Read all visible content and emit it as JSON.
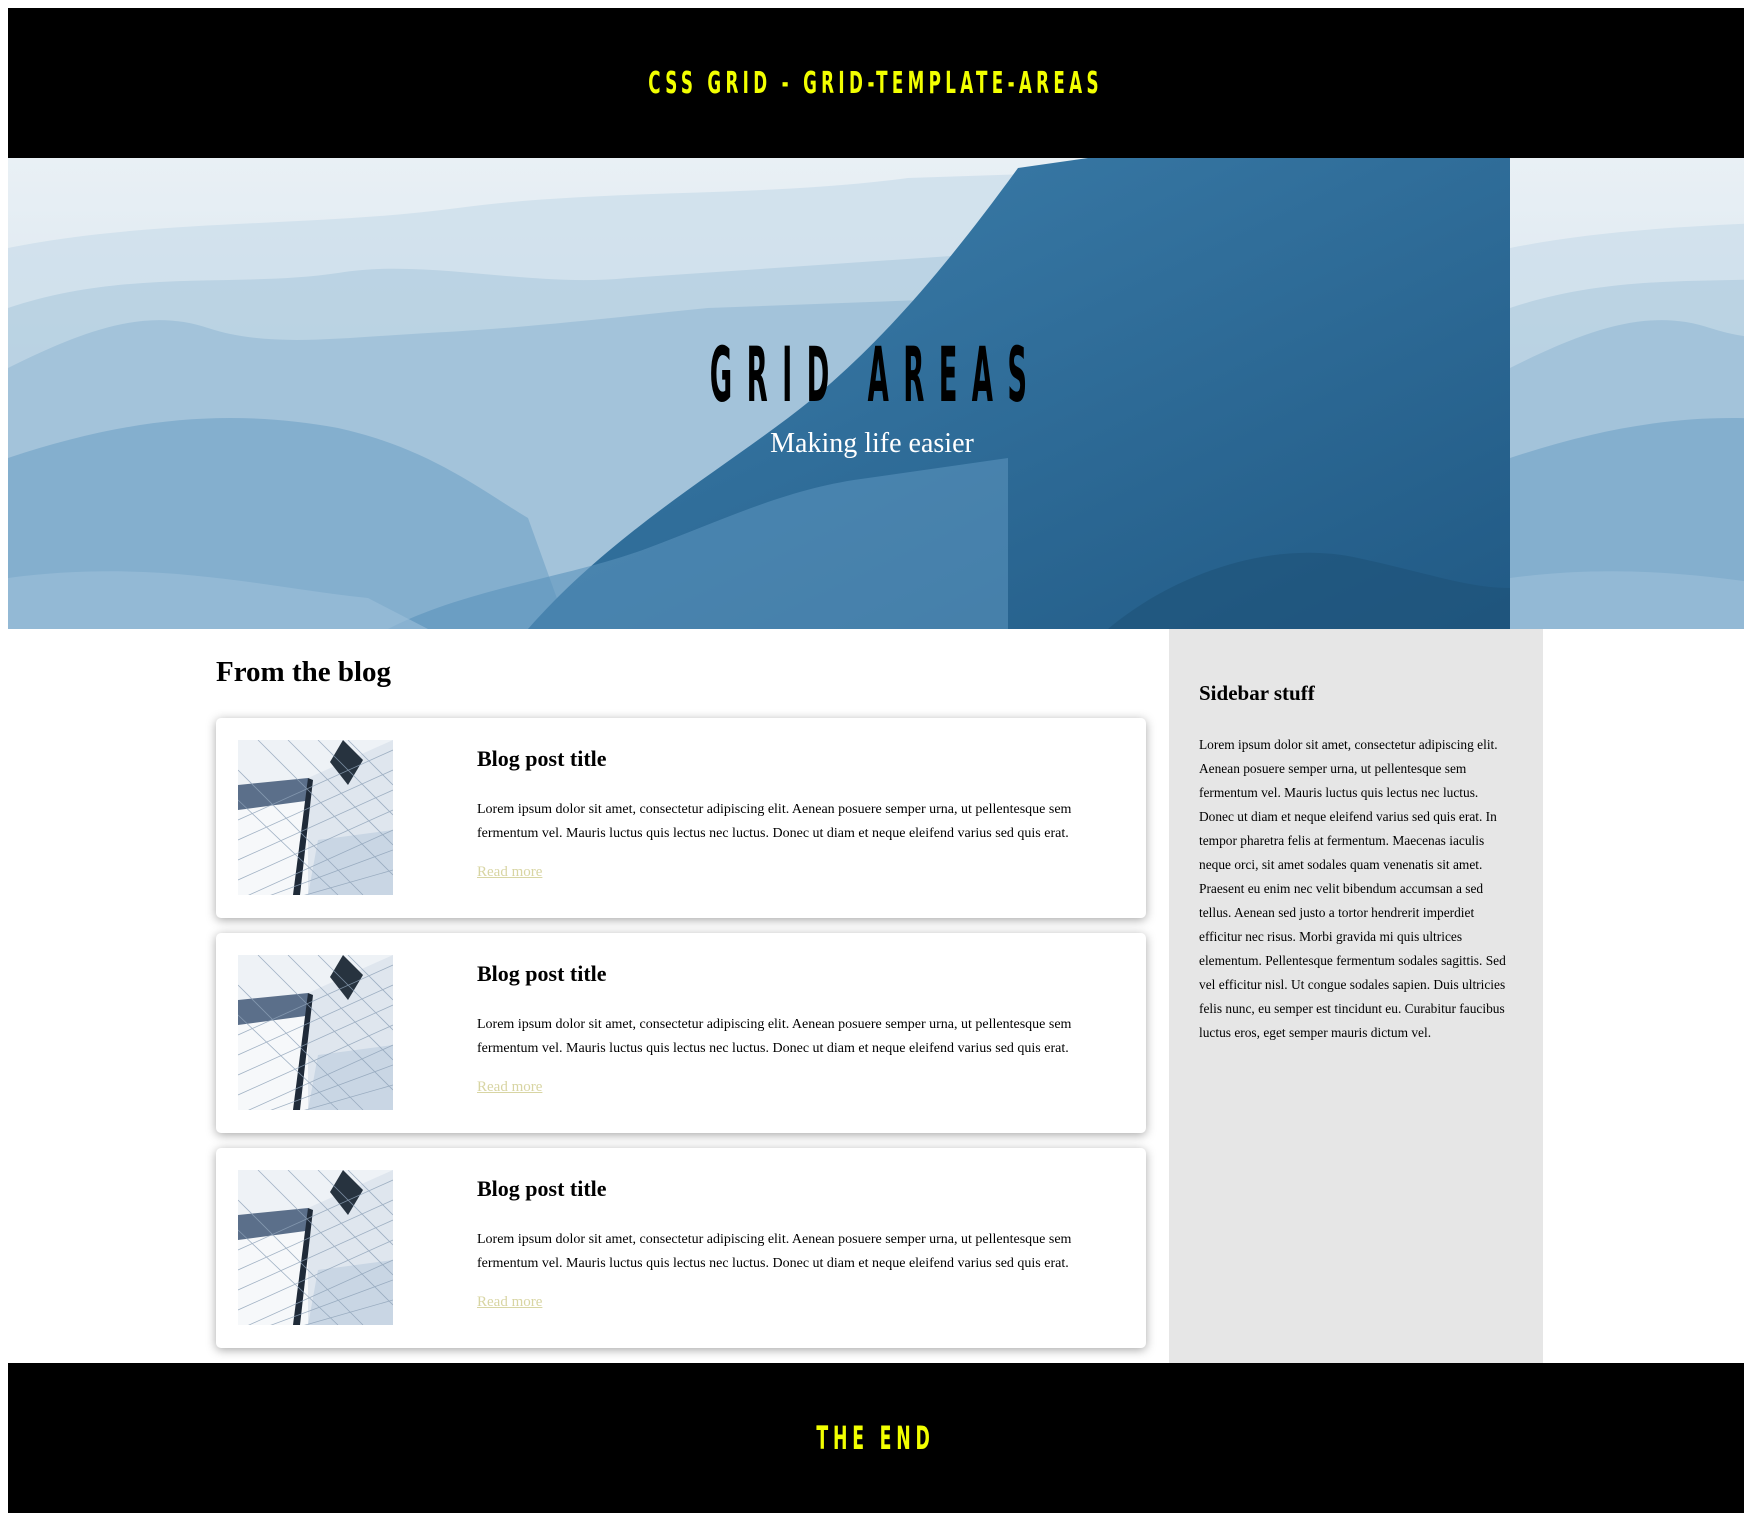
{
  "header": {
    "title": "CSS GRID - GRID-TEMPLATE-AREAS"
  },
  "hero": {
    "title": "GRID AREAS",
    "subtitle": "Making life easier"
  },
  "blog": {
    "heading": "From the blog",
    "posts": [
      {
        "title": "Blog post title",
        "excerpt": "Lorem ipsum dolor sit amet, consectetur adipiscing elit. Aenean posuere semper urna, ut pellentesque sem fermentum vel. Mauris luctus quis lectus nec luctus. Donec ut diam et neque eleifend varius sed quis erat.",
        "link": "Read more"
      },
      {
        "title": "Blog post title",
        "excerpt": "Lorem ipsum dolor sit amet, consectetur adipiscing elit. Aenean posuere semper urna, ut pellentesque sem fermentum vel. Mauris luctus quis lectus nec luctus. Donec ut diam et neque eleifend varius sed quis erat.",
        "link": "Read more"
      },
      {
        "title": "Blog post title",
        "excerpt": "Lorem ipsum dolor sit amet, consectetur adipiscing elit. Aenean posuere semper urna, ut pellentesque sem fermentum vel. Mauris luctus quis lectus nec luctus. Donec ut diam et neque eleifend varius sed quis erat.",
        "link": "Read more"
      }
    ]
  },
  "sidebar": {
    "title": "Sidebar stuff",
    "text": "Lorem ipsum dolor sit amet, consectetur adipiscing elit. Aenean posuere semper urna, ut pellentesque sem fermentum vel. Mauris luctus quis lectus nec luctus. Donec ut diam et neque eleifend varius sed quis erat. In tempor pharetra felis at fermentum. Maecenas iaculis neque orci, sit amet sodales quam venenatis sit amet. Praesent eu enim nec velit bibendum accumsan a sed tellus. Aenean sed justo a tortor hendrerit imperdiet efficitur nec risus. Morbi gravida mi quis ultrices elementum. Pellentesque fermentum sodales sagittis. Sed vel efficitur nisl. Ut congue sodales sapien. Duis ultricies felis nunc, eu semper est tincidunt eu. Curabitur faucibus luctus eros, eget semper mauris dictum vel."
  },
  "footer": {
    "title": "THE END"
  },
  "colors": {
    "header_bg": "#000000",
    "accent_yellow": "#f2ff00",
    "link_color": "#d8d5a3",
    "sidebar_bg": "#e6e6e6",
    "hero_blue_dark": "#2f6c97",
    "hero_blue_light": "#dfe9f1"
  },
  "images": {
    "hero": "misty-mountains-image",
    "post_thumb": "building-facade-image"
  }
}
